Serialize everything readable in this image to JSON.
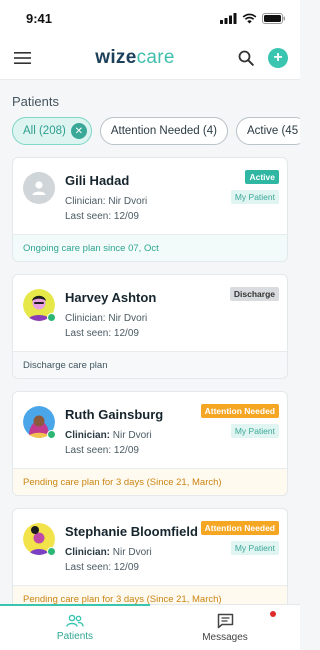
{
  "status_bar": {
    "time": "9:41"
  },
  "app": {
    "logo_part1": "wize",
    "logo_part2": "care",
    "menu_icon": "hamburger-menu-icon",
    "search_icon": "search-icon",
    "add_icon": "plus-circle-icon",
    "add_symbol": "+"
  },
  "section_title": "Patients",
  "filters": [
    {
      "label": "All (208)",
      "selected": true,
      "clear_symbol": "✕"
    },
    {
      "label": "Attention Needed (4)",
      "selected": false
    },
    {
      "label": "Active (45",
      "selected": false
    }
  ],
  "patients": [
    {
      "name": "Gili Hadad",
      "clinician_label": "Clinician:",
      "clinician": "Nir Dvori",
      "last_seen": "Last seen: 12/09",
      "status_badge": "Active",
      "my_patient": "My Patient",
      "footer": "Ongoing care plan since 07, Oct",
      "footer_color": "#2ea593"
    },
    {
      "name": "Harvey Ashton",
      "clinician_label": "Clinician:",
      "clinician": "Nir Dvori",
      "last_seen": "Last seen: 12/09",
      "status_badge": "Discharge",
      "footer": "Discharge care plan",
      "footer_color": "#3f5560"
    },
    {
      "name": "Ruth Gainsburg",
      "clinician_label": "Clinician:",
      "clinician": "Nir Dvori",
      "last_seen": "Last seen: 12/09",
      "status_badge": "Attention Needed",
      "my_patient": "My Patient",
      "footer": "Pending care plan for 3 days (Since 21, March)",
      "footer_color": "#c98512"
    },
    {
      "name": "Stephanie Bloomfield",
      "clinician_label": "Clinician:",
      "clinician": "Nir Dvori",
      "last_seen": "Last seen: 12/09",
      "status_badge": "Attention Needed",
      "my_patient": "My Patient",
      "footer": "Pending care plan for 3 days (Since 21, March)",
      "footer_color": "#c98512"
    }
  ],
  "bottom_nav": [
    {
      "label": "Patients",
      "icon": "patients-icon",
      "active": true
    },
    {
      "label": "Messages",
      "icon": "messages-icon",
      "active": false,
      "has_notification": true
    }
  ],
  "colors": {
    "accent": "#3ac5b1",
    "logo_dark": "#1c3f5a",
    "attention": "#f5a623",
    "online": "#2bb673",
    "notification": "#e02a2a"
  }
}
